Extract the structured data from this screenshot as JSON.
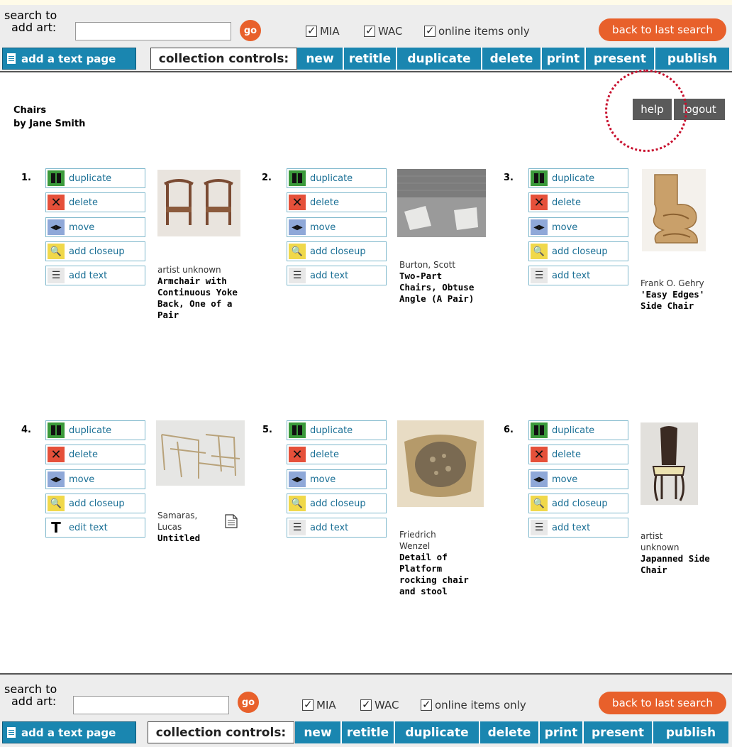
{
  "search": {
    "label_line1": "search to",
    "label_line2": "add art:",
    "input_value": "",
    "go_label": "go",
    "filters": [
      "MIA",
      "WAC",
      "online items only"
    ],
    "back_label": "back to last search"
  },
  "toolbar": {
    "add_text_page": "add a text page",
    "collection_controls_label": "collection controls:",
    "buttons": [
      "new",
      "retitle",
      "duplicate",
      "delete",
      "print",
      "present",
      "publish"
    ]
  },
  "collection": {
    "title": "Chairs",
    "author": "by Jane Smith"
  },
  "account": {
    "help": "help",
    "logout": "logout"
  },
  "items": [
    {
      "num": "1.",
      "actions": [
        "duplicate",
        "delete",
        "move",
        "add closeup",
        "add text"
      ],
      "artist": "artist unknown",
      "title": "Armchair with Continuous Yoke Back, One of a Pair"
    },
    {
      "num": "2.",
      "actions": [
        "duplicate",
        "delete",
        "move",
        "add closeup",
        "add text"
      ],
      "artist": "Burton, Scott",
      "title": "Two-Part Chairs, Obtuse Angle (A Pair)"
    },
    {
      "num": "3.",
      "actions": [
        "duplicate",
        "delete",
        "move",
        "add closeup",
        "add text"
      ],
      "artist": "Frank O. Gehry",
      "title": "'Easy Edges' Side Chair"
    },
    {
      "num": "4.",
      "actions": [
        "duplicate",
        "delete",
        "move",
        "add closeup",
        "edit text"
      ],
      "artist": "Samaras, Lucas",
      "title": "Untitled"
    },
    {
      "num": "5.",
      "actions": [
        "duplicate",
        "delete",
        "move",
        "add closeup",
        "add text"
      ],
      "artist": "Friedrich Wenzel",
      "title": "Detail of Platform rocking chair and stool"
    },
    {
      "num": "6.",
      "actions": [
        "duplicate",
        "delete",
        "move",
        "add closeup",
        "add text"
      ],
      "artist": "artist unknown",
      "title": "Japanned Side Chair"
    }
  ],
  "colors": {
    "toolbar_blue": "#1a86b0",
    "orange": "#e8602b",
    "help_ring": "#c8102e"
  }
}
